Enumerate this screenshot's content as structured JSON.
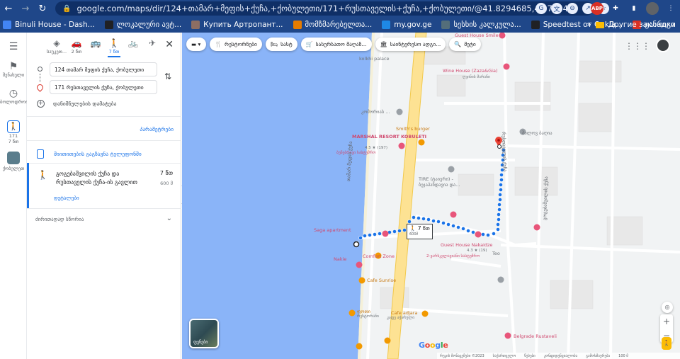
{
  "browser": {
    "url": "google.com/maps/dir/124+თამარ+მეფის+ქუჩა,+ქობულეთი/171+რუსთაველის+ქუჩა,+ქობულეთი/@41.8294685,41.7744...",
    "bookmarks": [
      {
        "label": "Binuli House - Dash...",
        "color": "#4285f4"
      },
      {
        "label": "ლოკალური ავტ...",
        "color": "#202124"
      },
      {
        "label": "Купить Артропант...",
        "color": "#8d6e63"
      },
      {
        "label": "მომზმარებელთა...",
        "color": "#e67c00"
      },
      {
        "label": "my.gov.ge",
        "color": "#1e88e5"
      },
      {
        "label": "სესხის კალკულა...",
        "color": "#546e7a"
      },
      {
        "label": "Speedtest от Ookla...",
        "color": "#202124"
      },
      {
        "label": "განრიგი",
        "color": "#d93025"
      }
    ],
    "other_bookmarks": "Другие закладки"
  },
  "rail": {
    "saved_label": "შენახული",
    "recent_label": "ბოლოდროინ",
    "walk_label_1": "171",
    "walk_label_2": "7 წთ",
    "kobuleti_label": "ქობულეთ"
  },
  "directions": {
    "modes": [
      {
        "icon": "◈",
        "label": "საუკეთ..."
      },
      {
        "icon": "🚗",
        "label": "2 წთ"
      },
      {
        "icon": "🚌",
        "label": ""
      },
      {
        "icon": "🚶",
        "label": "7 წთ"
      },
      {
        "icon": "🚲",
        "label": ""
      },
      {
        "icon": "✈",
        "label": ""
      }
    ],
    "origin": "124 თამარ მეფის ქუჩა, ქობულეთი",
    "destination": "171 რუსთაველის ქუჩა, ქობულეთი",
    "add_destination": "დანიშნულების დამატება",
    "options": "პარამეტრები",
    "send_to_phone": "მიითითების გაგზავნა ტელეფონში",
    "route": {
      "name": "გოგებაშვილის ქუჩა და რუსთაველის ქუჩა-ის გავლით",
      "time": "7 წთ",
      "distance": "600 მ",
      "details": "დეტალები"
    },
    "history": "ძირითადად სწორია"
  },
  "map": {
    "chips": [
      {
        "icon": "🍴",
        "label": "რესტორნები"
      },
      {
        "icon": "🛏",
        "label": "სასტ"
      },
      {
        "icon": "🛒",
        "label": "სასურსათო მაღაზ..."
      },
      {
        "icon": "🏛",
        "label": "საინტერესო ადგი..."
      },
      {
        "icon": "🔍",
        "label": "მეტი"
      }
    ],
    "pois": {
      "guest_house_smile": "Guest House Smile",
      "kolkhi_palace": "kolkhi palace",
      "wine_house": "Wine House (Zaza&Gia)",
      "wine_house_sub": "ღვინის მარანი",
      "iberia": "კომორიას ...",
      "smiths": "Smith's burger",
      "marshal": "MARSHAL RESORT KOBULETI",
      "marshal_rating": "4.5 ★ (197)",
      "marshal_sub": "ბუნებრივი სასტუმრო",
      "tire": "TIRE (ტაიერი) - ბეჯაპანდავია და...",
      "saga": "Saga apartment",
      "guest_house_nakaidze": "Guest House Nakaidze",
      "nakaidze_rating": "4.3 ★ (19)",
      "nakaidze_sub": "2-ვარსკვლავიანი სასტუმრო",
      "teo": "Teo",
      "comfort": "Comfort Zone",
      "nakie": "Nakie",
      "cafe_sunrise": "Cafe Sunrise",
      "poti": "ფოთი",
      "poti_sub": "რესტორანი",
      "cafe_adjara": "Cafe adjara",
      "cafe_adjara_sub": "კაფე აჭარული",
      "belgrade": "Belgrade Rustaveli",
      "shiloba": "შილოვ ბაღია"
    },
    "streets": {
      "tamar": "თამარ მეფის ქუჩა",
      "rustaveli": "რუსთაველის ქუჩა",
      "gogebashvili": "გოგებაშვილის ქუჩა"
    },
    "route_time": "7 წთ",
    "route_dist": "600მ",
    "satellite_label": "ფენები",
    "google": "Google",
    "footer": [
      "რუკის მონაცემები ©2023",
      "საქართველო",
      "წესები",
      "კონფიდენციალობა",
      "გამოხმაურება",
      "100 მ"
    ]
  }
}
